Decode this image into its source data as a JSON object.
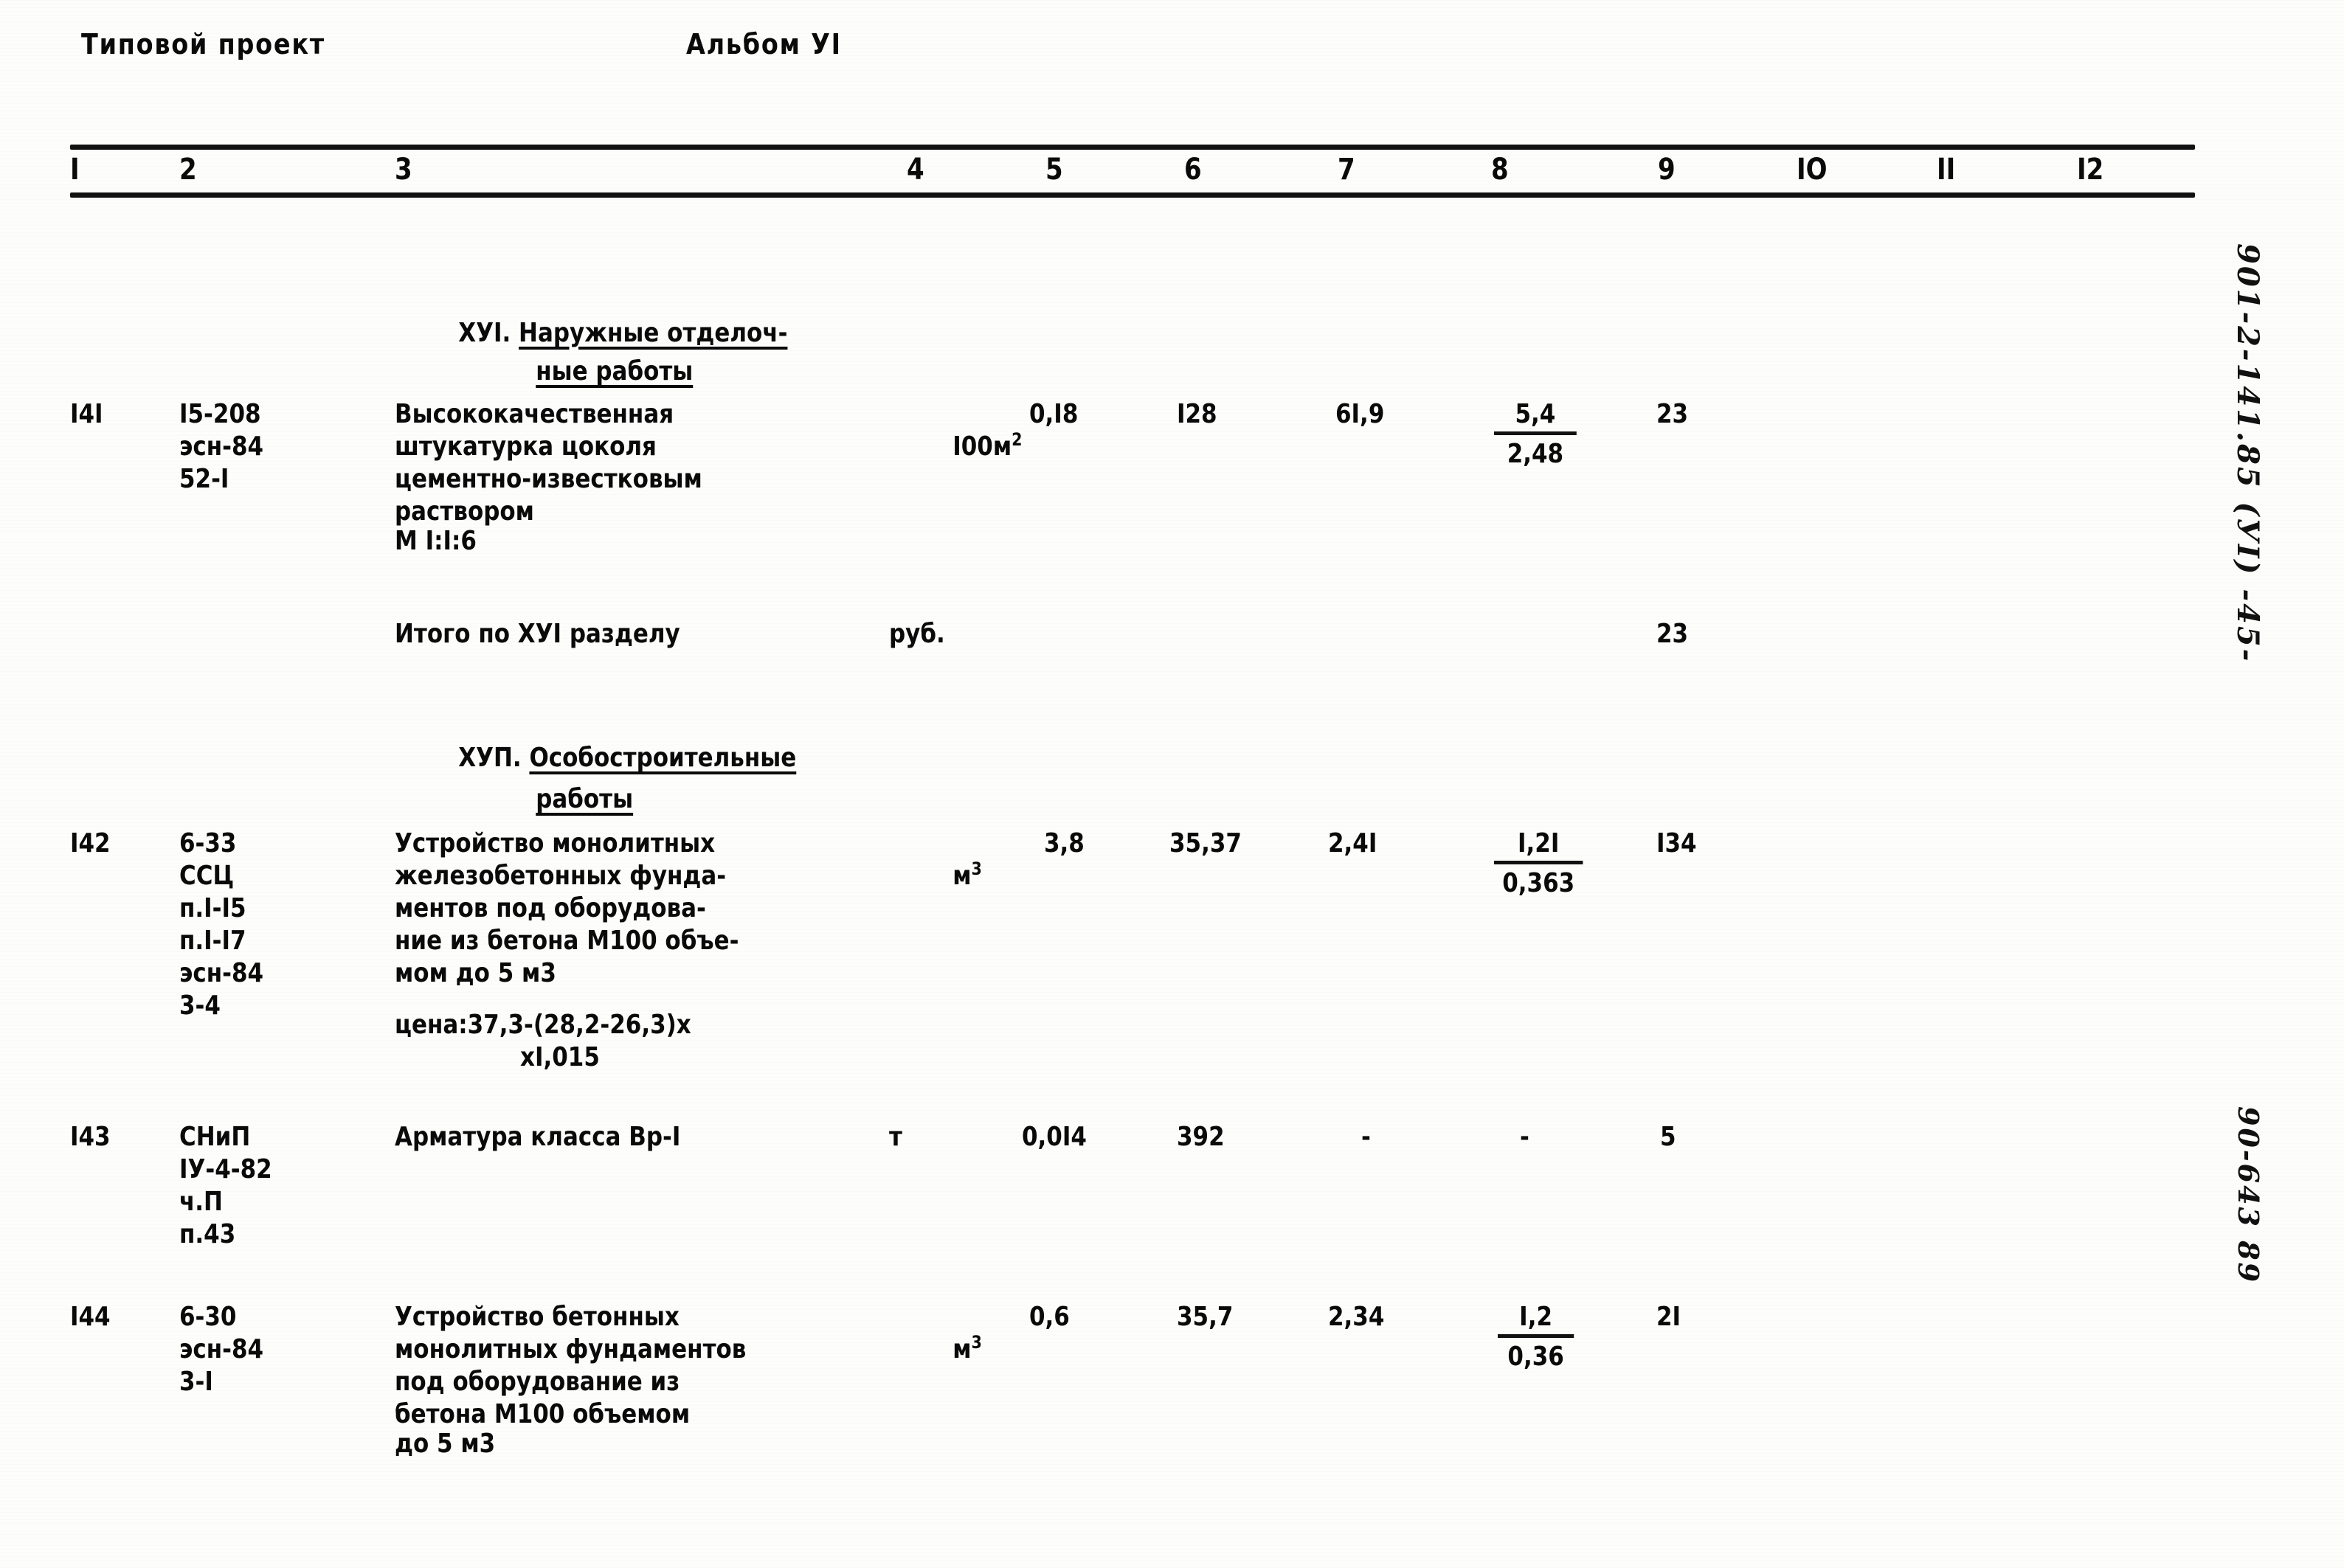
{
  "header": {
    "left": "Типовой проект",
    "right": "Альбом УI"
  },
  "table": {
    "column_numbers": [
      "I",
      "2",
      "3",
      "4",
      "5",
      "6",
      "7",
      "8",
      "9",
      "IO",
      "II",
      "I2"
    ],
    "sections": [
      {
        "number": "ХУI.",
        "title_line1": "Наружные отделоч-",
        "title_line2": "ные работы"
      },
      {
        "number": "ХУП.",
        "title_line1": "Особостроительные",
        "title_line2": "работы"
      }
    ],
    "rows": [
      {
        "c1": "I4I",
        "c2": [
          "I5-208",
          "эсн-84",
          "52-I"
        ],
        "c3": [
          "Высококачественная",
          "штукатурка цоколя",
          "цементно-известковым",
          "раствором",
          "М I:I:6"
        ],
        "c4_base": "I00м",
        "c4_exp": "2",
        "c5": "0,I8",
        "c6": "I28",
        "c7": "6I,9",
        "c8_num": "5,4",
        "c8_den": "2,48",
        "c9": "23"
      },
      {
        "c1": "",
        "c2": [],
        "c3": [
          "Итого по ХУI разделу"
        ],
        "c4_base": "руб.",
        "c4_exp": "",
        "c5": "",
        "c6": "",
        "c7": "",
        "c8_num": "",
        "c8_den": "",
        "c9": "23"
      },
      {
        "c1": "I42",
        "c2": [
          "6-33",
          "ССЦ",
          "п.I-I5",
          "п.I-I7",
          "эсн-84",
          "3-4"
        ],
        "c3": [
          "Устройство монолитных",
          "железобетонных фунда-",
          "ментов под оборудова-",
          "ние из бетона М100 объе-",
          "мом до 5 м3"
        ],
        "c3_note_line1": "цена:37,3-(28,2-26,3)х",
        "c3_note_line2": "хI,015",
        "c4_base": "м",
        "c4_exp": "3",
        "c5": "3,8",
        "c6": "35,37",
        "c7": "2,4I",
        "c8_num": "I,2I",
        "c8_den": "0,363",
        "c9": "I34"
      },
      {
        "c1": "I43",
        "c2": [
          "СНиП",
          "IУ-4-82",
          "ч.П",
          "п.43"
        ],
        "c3": [
          "Арматура класса Вр-I"
        ],
        "c4_base": "т",
        "c4_exp": "",
        "c5": "0,0I4",
        "c6": "392",
        "c7": "-",
        "c8_num": "-",
        "c8_den": "",
        "c9": "5"
      },
      {
        "c1": "I44",
        "c2": [
          "6-30",
          "эсн-84",
          "3-I"
        ],
        "c3": [
          "Устройство бетонных",
          "монолитных фундаментов",
          "под оборудование из",
          "бетона М100 объемом",
          "до 5 м3"
        ],
        "c4_base": "м",
        "c4_exp": "3",
        "c5": "0,6",
        "c6": "35,7",
        "c7": "2,34",
        "c8_num": "I,2",
        "c8_den": "0,36",
        "c9": "2I"
      }
    ]
  },
  "margin_notes": {
    "top": "901-2-141.85  (УI)  -45-",
    "bottom": "90-643 89"
  }
}
